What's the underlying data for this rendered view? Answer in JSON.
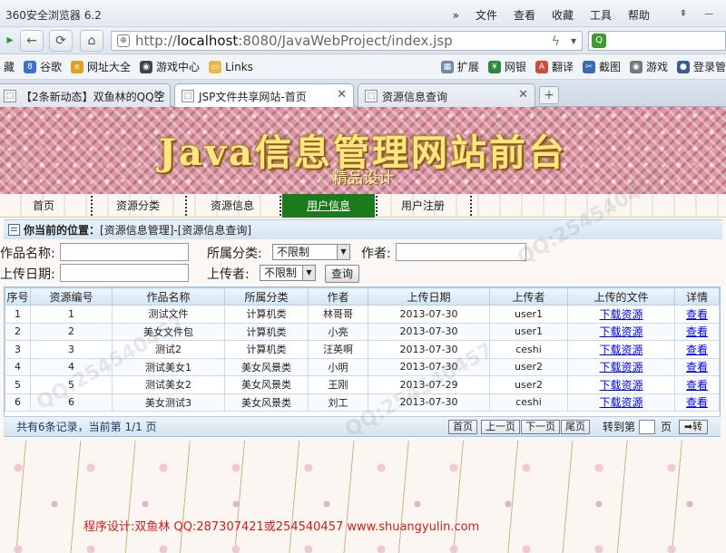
{
  "browser": {
    "name": "360安全浏览器 6.2",
    "menu": [
      "文件",
      "查看",
      "收藏",
      "工具",
      "帮助"
    ],
    "url_prefix": "http://",
    "url_host": "localhost",
    "url_path": ":8080/JavaWebProject/index.jsp",
    "favorites": [
      "谷歌",
      "网址大全",
      "游戏中心",
      "Links"
    ],
    "favorites_left": "藏",
    "tools": [
      "扩展",
      "网银",
      "翻译",
      "截图",
      "游戏",
      "登录管"
    ],
    "tabs": [
      {
        "label": "【2条新动态】双鱼林的QQ空"
      },
      {
        "label": "JSP文件共享网站-首页"
      },
      {
        "label": "资源信息查询"
      }
    ]
  },
  "site": {
    "title": "Java信息管理网站前台",
    "subtitle": "精品设计",
    "nav": [
      "首页",
      "资源分类",
      "资源信息",
      "用户信息",
      "用户注册"
    ],
    "active_nav": 3
  },
  "location": {
    "label": "你当前的位置：",
    "path": "[资源信息管理]-[资源信息查询]"
  },
  "search": {
    "work_name_label": "作品名称:",
    "work_name_value": "",
    "category_label": "所属分类:",
    "category_value": "不限制",
    "author_label": "作者:",
    "author_value": "",
    "date_label": "上传日期:",
    "date_value": "",
    "uploader_label": "上传者:",
    "uploader_value": "不限制",
    "query_button": "查询"
  },
  "table": {
    "headers": [
      "序号",
      "资源编号",
      "作品名称",
      "所属分类",
      "作者",
      "上传日期",
      "上传者",
      "上传的文件",
      "详情"
    ],
    "rows": [
      [
        "1",
        "1",
        "测试文件",
        "计算机类",
        "林哥哥",
        "2013-07-30",
        "user1",
        "下载资源",
        "查看"
      ],
      [
        "2",
        "2",
        "美女文件包",
        "计算机类",
        "小亮",
        "2013-07-30",
        "user1",
        "下载资源",
        "查看"
      ],
      [
        "3",
        "3",
        "测试2",
        "计算机类",
        "汪英啊",
        "2013-07-30",
        "ceshi",
        "下载资源",
        "查看"
      ],
      [
        "4",
        "4",
        "测试美女1",
        "美女风景类",
        "小明",
        "2013-07-30",
        "user2",
        "下载资源",
        "查看"
      ],
      [
        "5",
        "5",
        "测试美女2",
        "美女风景类",
        "王刚",
        "2013-07-29",
        "user2",
        "下载资源",
        "查看"
      ],
      [
        "6",
        "6",
        "美女测试3",
        "美女风景类",
        "刘工",
        "2013-07-30",
        "ceshi",
        "下载资源",
        "查看"
      ]
    ]
  },
  "pager": {
    "info": "共有6条记录，当前第 1/1 页",
    "first": "首页",
    "prev": "上一页",
    "next": "下一页",
    "last": "尾页",
    "goto_label": "转到第",
    "page_label": "页",
    "go_button": "➡转"
  },
  "credit": "程序设计:双鱼林 QQ:287307421或254540457 www.shuangyulin.com",
  "watermark": "QQ:254540457"
}
